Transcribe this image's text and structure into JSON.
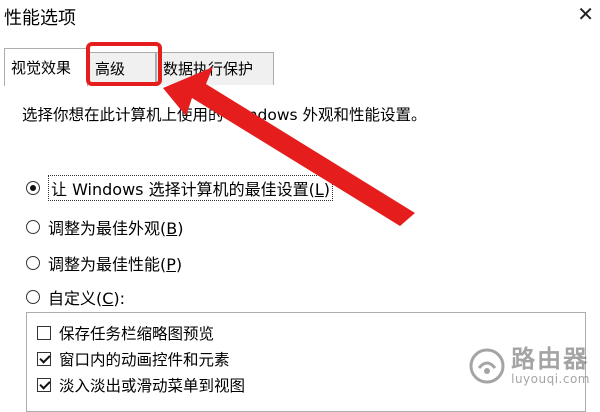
{
  "window": {
    "title": "性能选项"
  },
  "tabs": [
    {
      "label": "视觉效果",
      "active": true
    },
    {
      "label": "高级",
      "active": false
    },
    {
      "label": "数据执行保护",
      "active": false
    }
  ],
  "description": "选择你想在此计算机上使用的 Windows 外观和性能设置。",
  "radios": [
    {
      "text": "让 Windows 选择计算机的最佳设置(",
      "key": "L",
      "close": ")",
      "checked": true
    },
    {
      "text": "调整为最佳外观(",
      "key": "B",
      "close": ")",
      "checked": false
    },
    {
      "text": "调整为最佳性能(",
      "key": "P",
      "close": ")",
      "checked": false
    },
    {
      "text": "自定义(",
      "key": "C",
      "close": "):",
      "checked": false
    }
  ],
  "effects": [
    {
      "label": "保存任务栏缩略图预览",
      "checked": false
    },
    {
      "label": "窗口内的动画控件和元素",
      "checked": true
    },
    {
      "label": "淡入淡出或滑动菜单到视图",
      "checked": true
    }
  ],
  "watermark": {
    "name": "路由器",
    "url": "luyouqi.com"
  },
  "colors": {
    "annotation": "#e51d1d",
    "border": "#adadad"
  },
  "icons": {
    "close": "close-icon",
    "watermark": "router-logo-icon"
  }
}
